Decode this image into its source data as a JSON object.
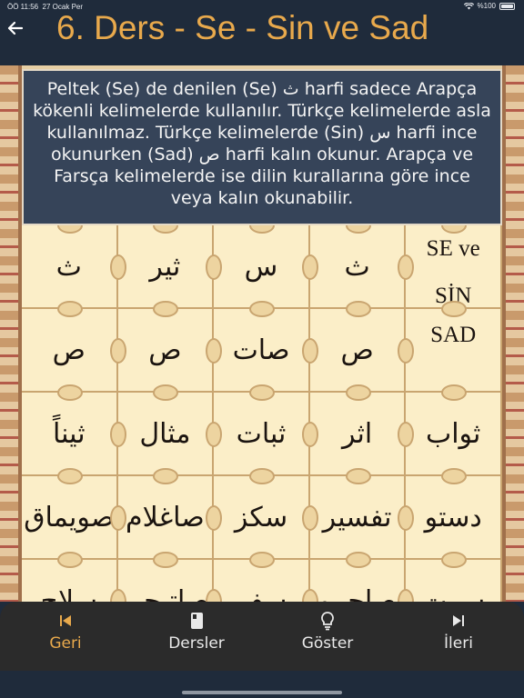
{
  "status": {
    "time": "ÖÖ 11:56",
    "date": "27 Ocak Per",
    "battery": "%100"
  },
  "header": {
    "title": "6. Ders - Se - Sin ve Sad"
  },
  "info": {
    "text": "Peltek (Se) de denilen (Se) ث harfi sadece Arapça kökenli kelimelerde kullanılır. Türkçe kelimelerde asla kullanılmaz. Türkçe kelimelerde (Sin) س harfi ince okunurken (Sad) ص harfi kalın okunur. Arapça ve Farsça kelimelerde ise dilin kurallarına göre ince veya kalın okunabilir."
  },
  "grid": {
    "rows": [
      [
        "ث",
        "ثير",
        "س",
        "ث",
        "SE ve SİN"
      ],
      [
        "ص",
        "ص",
        "صات",
        "ص",
        "SAD"
      ],
      [
        "ثيناً",
        "مثال",
        "ثبات",
        "اثر",
        "ثواب"
      ],
      [
        "صويماق",
        "صاغلام",
        "سكز",
        "تفسير",
        "دستو"
      ],
      [
        "سلاح",
        "صاتيجى",
        "سفر",
        "صاچمو",
        "سرت"
      ]
    ]
  },
  "tabs": [
    {
      "label": "Geri",
      "icon": "skip-back-icon"
    },
    {
      "label": "Dersler",
      "icon": "book-icon"
    },
    {
      "label": "Göster",
      "icon": "lightbulb-icon"
    },
    {
      "label": "İleri",
      "icon": "skip-forward-icon"
    }
  ],
  "colors": {
    "background": "#1f2b3b",
    "title": "#e8a94c",
    "active_tab": "#e8a94c",
    "info_box": "#364459",
    "cell": "#fbeec8"
  }
}
